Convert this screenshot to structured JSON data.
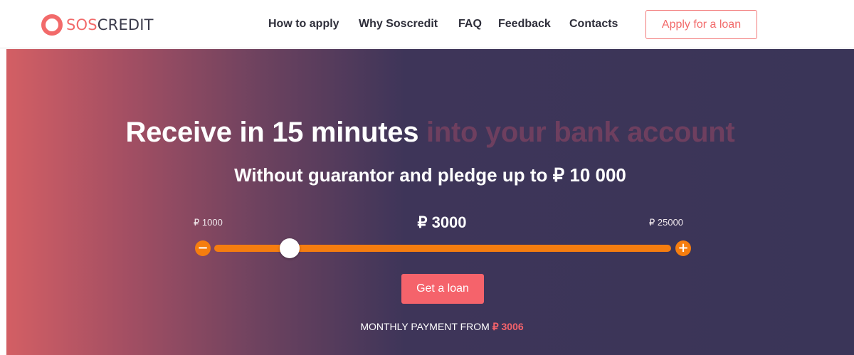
{
  "brand": {
    "name_part1": "SOS",
    "name_part2": "CREDIT",
    "accent_color": "#f26a6a"
  },
  "nav": {
    "items": [
      "How to apply",
      "Why Soscredit",
      "FAQ",
      "Feedback",
      "Contacts"
    ],
    "apply_label": "Apply for a loan"
  },
  "hero": {
    "headline_main": "Receive in 15 minutes",
    "headline_faded": "into your bank account",
    "subheadline": "Without guarantor and pledge up to ₽ 10 000",
    "gradient_colors": [
      "#d35f64",
      "#3a3558"
    ]
  },
  "slider": {
    "min_label": "₽ 1000",
    "max_label": "₽ 25000",
    "current_label": "₽ 3000",
    "min": 1000,
    "max": 25000,
    "value": 3000,
    "minus_symbol": "−",
    "plus_symbol": "+",
    "track_color": "#f57d0f"
  },
  "cta": {
    "get_loan_label": "Get a loan",
    "monthly_prefix": "MONTHLY PAYMENT FROM",
    "monthly_amount": "₽ 3006"
  }
}
